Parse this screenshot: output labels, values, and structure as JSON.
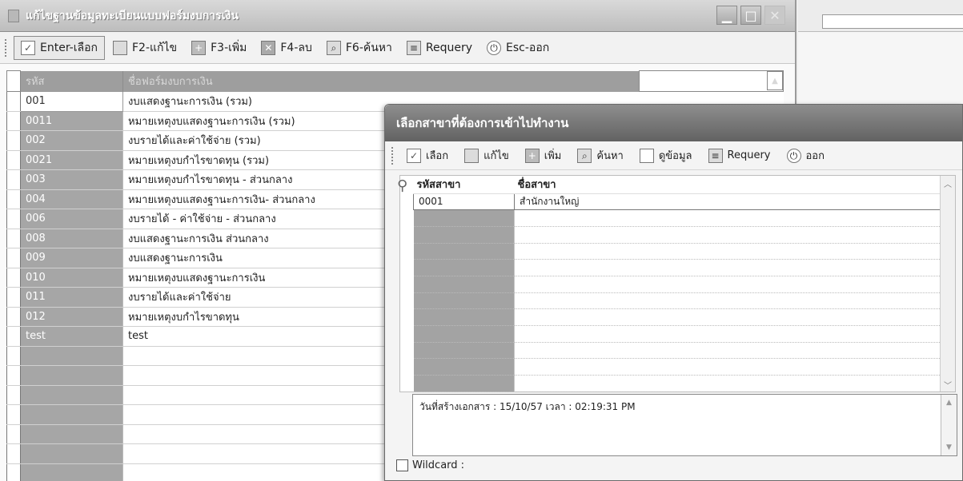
{
  "main_window": {
    "title": "แก้ไขฐานข้อมูลทะเบียนแบบฟอร์มงบการเงิน",
    "toolbar": [
      {
        "label": "Enter-เลือก",
        "icon": "check-icon"
      },
      {
        "label": "F2-แก้ไข",
        "icon": "edit-icon"
      },
      {
        "label": "F3-เพิ่ม",
        "icon": "add-icon"
      },
      {
        "label": "F4-ลบ",
        "icon": "delete-icon"
      },
      {
        "label": "F6-ค้นหา",
        "icon": "search-icon"
      },
      {
        "label": "Requery",
        "icon": "requery-icon"
      },
      {
        "label": "Esc-ออก",
        "icon": "power-icon"
      }
    ],
    "grid": {
      "columns": [
        "รหัส",
        "ชื่อฟอร์มงบการเงิน"
      ],
      "rows": [
        {
          "code": "001",
          "name": "งบแสดงฐานะการเงิน (รวม)"
        },
        {
          "code": "0011",
          "name": "หมายเหตุงบแสดงฐานะการเงิน (รวม)"
        },
        {
          "code": "002",
          "name": "งบรายได้และค่าใช้จ่าย (รวม)"
        },
        {
          "code": "0021",
          "name": "หมายเหตุงบกำไรขาดทุน (รวม)"
        },
        {
          "code": "003",
          "name": "หมายเหตุงบกำไรขาดทุน - ส่วนกลาง"
        },
        {
          "code": "004",
          "name": "หมายเหตุงบแสดงฐานะการเงิน- ส่วนกลาง"
        },
        {
          "code": "006",
          "name": "งบรายได้ - ค่าใช้จ่าย - ส่วนกลาง"
        },
        {
          "code": "008",
          "name": "งบแสดงฐานะการเงิน ส่วนกลาง"
        },
        {
          "code": "009",
          "name": "งบแสดงฐานะการเงิน"
        },
        {
          "code": "010",
          "name": "หมายเหตุงบแสดงฐานะการเงิน"
        },
        {
          "code": "011",
          "name": "งบรายได้และค่าใช้จ่าย"
        },
        {
          "code": "012",
          "name": "หมายเหตุงบกำไรขาดทุน"
        },
        {
          "code": "test",
          "name": "test"
        },
        {
          "code": "",
          "name": ""
        },
        {
          "code": "",
          "name": ""
        },
        {
          "code": "",
          "name": ""
        },
        {
          "code": "",
          "name": ""
        },
        {
          "code": "",
          "name": ""
        },
        {
          "code": "",
          "name": ""
        },
        {
          "code": "",
          "name": ""
        }
      ]
    }
  },
  "dialog": {
    "title": "เลือกสาขาที่ต้องการเข้าไปทำงาน",
    "toolbar": [
      {
        "label": "เลือก",
        "icon": "check-icon"
      },
      {
        "label": "แก้ไข",
        "icon": "edit-icon"
      },
      {
        "label": "เพิ่ม",
        "icon": "add-icon"
      },
      {
        "label": "ค้นหา",
        "icon": "search-icon"
      },
      {
        "label": "ดูข้อมูล",
        "icon": "document-icon"
      },
      {
        "label": "Requery",
        "icon": "requery-icon"
      },
      {
        "label": "ออก",
        "icon": "power-icon"
      }
    ],
    "grid": {
      "columns": [
        "รหัสสาขา",
        "ชื่อสาขา"
      ],
      "rows": [
        {
          "code": "0001",
          "name": "สำนักงานใหญ่"
        },
        {
          "code": "",
          "name": ""
        },
        {
          "code": "",
          "name": ""
        },
        {
          "code": "",
          "name": ""
        },
        {
          "code": "",
          "name": ""
        },
        {
          "code": "",
          "name": ""
        },
        {
          "code": "",
          "name": ""
        },
        {
          "code": "",
          "name": ""
        },
        {
          "code": "",
          "name": ""
        },
        {
          "code": "",
          "name": ""
        },
        {
          "code": "",
          "name": ""
        },
        {
          "code": "",
          "name": ""
        }
      ]
    },
    "memo": "วันที่สร้างเอกสาร : 15/10/57 เวลา : 02:19:31 PM",
    "wildcard_label": "Wildcard :"
  }
}
